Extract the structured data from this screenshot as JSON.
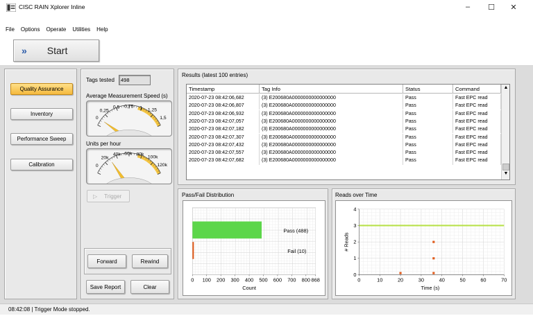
{
  "window": {
    "title": "CISC RAIN Xplorer Inline",
    "controls": {
      "minimize": "–",
      "maximize": "☐",
      "close": "✕"
    }
  },
  "menu": [
    "File",
    "Options",
    "Operate",
    "Utilities",
    "Help"
  ],
  "toolbar": {
    "start_label": "Start",
    "start_icon": "»"
  },
  "nav": {
    "items": [
      {
        "label": "Quality Assurance",
        "active": true
      },
      {
        "label": "Inventory",
        "active": false
      },
      {
        "label": "Performance Sweep",
        "active": false
      },
      {
        "label": "Calibration",
        "active": false
      }
    ]
  },
  "controls": {
    "tags_tested_label": "Tags tested",
    "tags_tested_value": "498",
    "speed_gauge": {
      "label": "Average Measurement Speed (s)",
      "ticks": [
        "0",
        "0,25",
        "0,5",
        "0,75",
        "1",
        "1,25",
        "1,5"
      ],
      "min": 0,
      "max": 1.5,
      "value": 0.125,
      "highlight_from": 0.93,
      "highlight_to": 1.5
    },
    "units_gauge": {
      "label": "Units per hour",
      "ticks": [
        "0",
        "20k",
        "40k",
        "60k",
        "80k",
        "100k",
        "120k"
      ],
      "min": 0,
      "max": 120000,
      "value": 28800,
      "highlight_from": 74000,
      "highlight_to": 120000
    },
    "trigger_label": "Trigger",
    "forward_label": "Forward",
    "rewind_label": "Rewind",
    "save_report_label": "Save Report",
    "clear_label": "Clear"
  },
  "results": {
    "title": "Results (latest 100 entries)",
    "columns": [
      "Timestamp",
      "Tag Info",
      "Status",
      "Command"
    ],
    "rows": [
      [
        "2020-07-23 08:42:06,682",
        "(3) E200680A0000000000000000",
        "Pass",
        "Fast EPC read"
      ],
      [
        "2020-07-23 08:42:06,807",
        "(3) E200680A0000000000000000",
        "Pass",
        "Fast EPC read"
      ],
      [
        "2020-07-23 08:42:06,932",
        "(3) E200680A0000000000000000",
        "Pass",
        "Fast EPC read"
      ],
      [
        "2020-07-23 08:42:07,057",
        "(3) E200680A0000000000000000",
        "Pass",
        "Fast EPC read"
      ],
      [
        "2020-07-23 08:42:07,182",
        "(3) E200680A0000000000000000",
        "Pass",
        "Fast EPC read"
      ],
      [
        "2020-07-23 08:42:07,307",
        "(3) E200680A0000000000000000",
        "Pass",
        "Fast EPC read"
      ],
      [
        "2020-07-23 08:42:07,432",
        "(3) E200680A0000000000000000",
        "Pass",
        "Fast EPC read"
      ],
      [
        "2020-07-23 08:42:07,557",
        "(3) E200680A0000000000000000",
        "Pass",
        "Fast EPC read"
      ],
      [
        "2020-07-23 08:42:07,682",
        "(3) E200680A0000000000000000",
        "Pass",
        "Fast EPC read"
      ]
    ]
  },
  "chart_data": [
    {
      "type": "bar",
      "orientation": "horizontal",
      "title": "Pass/Fail Distribution",
      "categories": [
        "Pass (488)",
        "Fail (10)"
      ],
      "values": [
        488,
        10
      ],
      "colors": [
        "#5cd64a",
        "#e05a1a"
      ],
      "xlabel": "Count",
      "xlim": [
        0,
        868
      ],
      "xticks": [
        "0",
        "100",
        "200",
        "300",
        "400",
        "500",
        "600",
        "700",
        "800",
        "868"
      ],
      "grid": true
    },
    {
      "type": "scatter",
      "title": "Reads over Time",
      "xlabel": "Time (s)",
      "ylabel": "# Reads",
      "xlim": [
        0,
        70
      ],
      "ylim": [
        0,
        4
      ],
      "xticks": [
        "0",
        "10",
        "20",
        "30",
        "40",
        "50",
        "60",
        "70"
      ],
      "yticks": [
        "0",
        "1",
        "2",
        "3",
        "4"
      ],
      "grid": true,
      "series": [
        {
          "color": "#b8e04a",
          "style": "line",
          "points": [
            [
              0,
              3
            ],
            [
              62,
              3
            ],
            [
              70,
              3
            ]
          ]
        },
        {
          "color": "#e05a1a",
          "style": "points",
          "points": [
            [
              20,
              0.1
            ],
            [
              36,
              2
            ],
            [
              36,
              1
            ],
            [
              36,
              0.1
            ]
          ]
        }
      ]
    }
  ],
  "status_bar": "08:42:08 | Trigger Mode stopped."
}
